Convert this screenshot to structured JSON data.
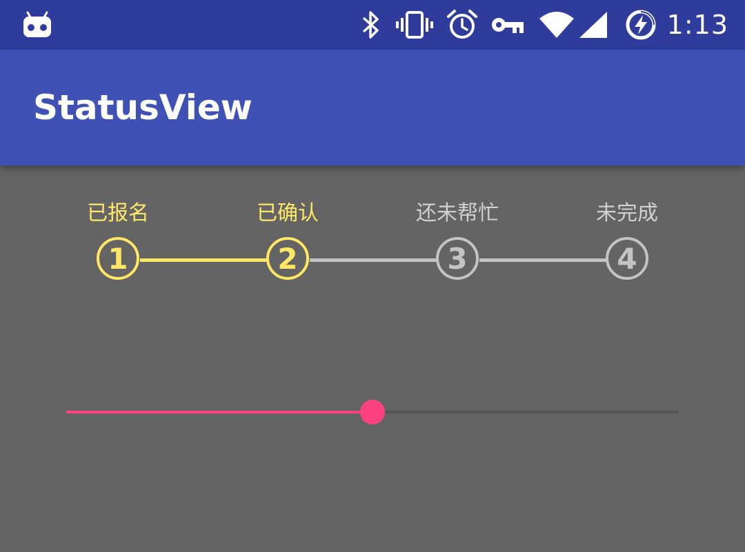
{
  "status_bar": {
    "time": "1:13",
    "icons": [
      "android-debug-icon",
      "bluetooth-icon",
      "vibrate-icon",
      "alarm-icon",
      "vpn-key-icon",
      "wifi-icon",
      "cell-signal-icon",
      "battery-charging-icon"
    ]
  },
  "app_bar": {
    "title": "StatusView"
  },
  "steps": [
    {
      "number": "1",
      "label": "已报名",
      "state": "done"
    },
    {
      "number": "2",
      "label": "已确认",
      "state": "done"
    },
    {
      "number": "3",
      "label": "还未帮忙",
      "state": "todo"
    },
    {
      "number": "4",
      "label": "未完成",
      "state": "todo"
    }
  ],
  "seekbar": {
    "progress": 0.5
  },
  "colors": {
    "status_bar": "#2F3C9C",
    "app_bar": "#3F51B5",
    "background": "#646464",
    "step_done": "#FFE866",
    "step_todo": "#C4C4C4",
    "accent": "#FF4081"
  }
}
